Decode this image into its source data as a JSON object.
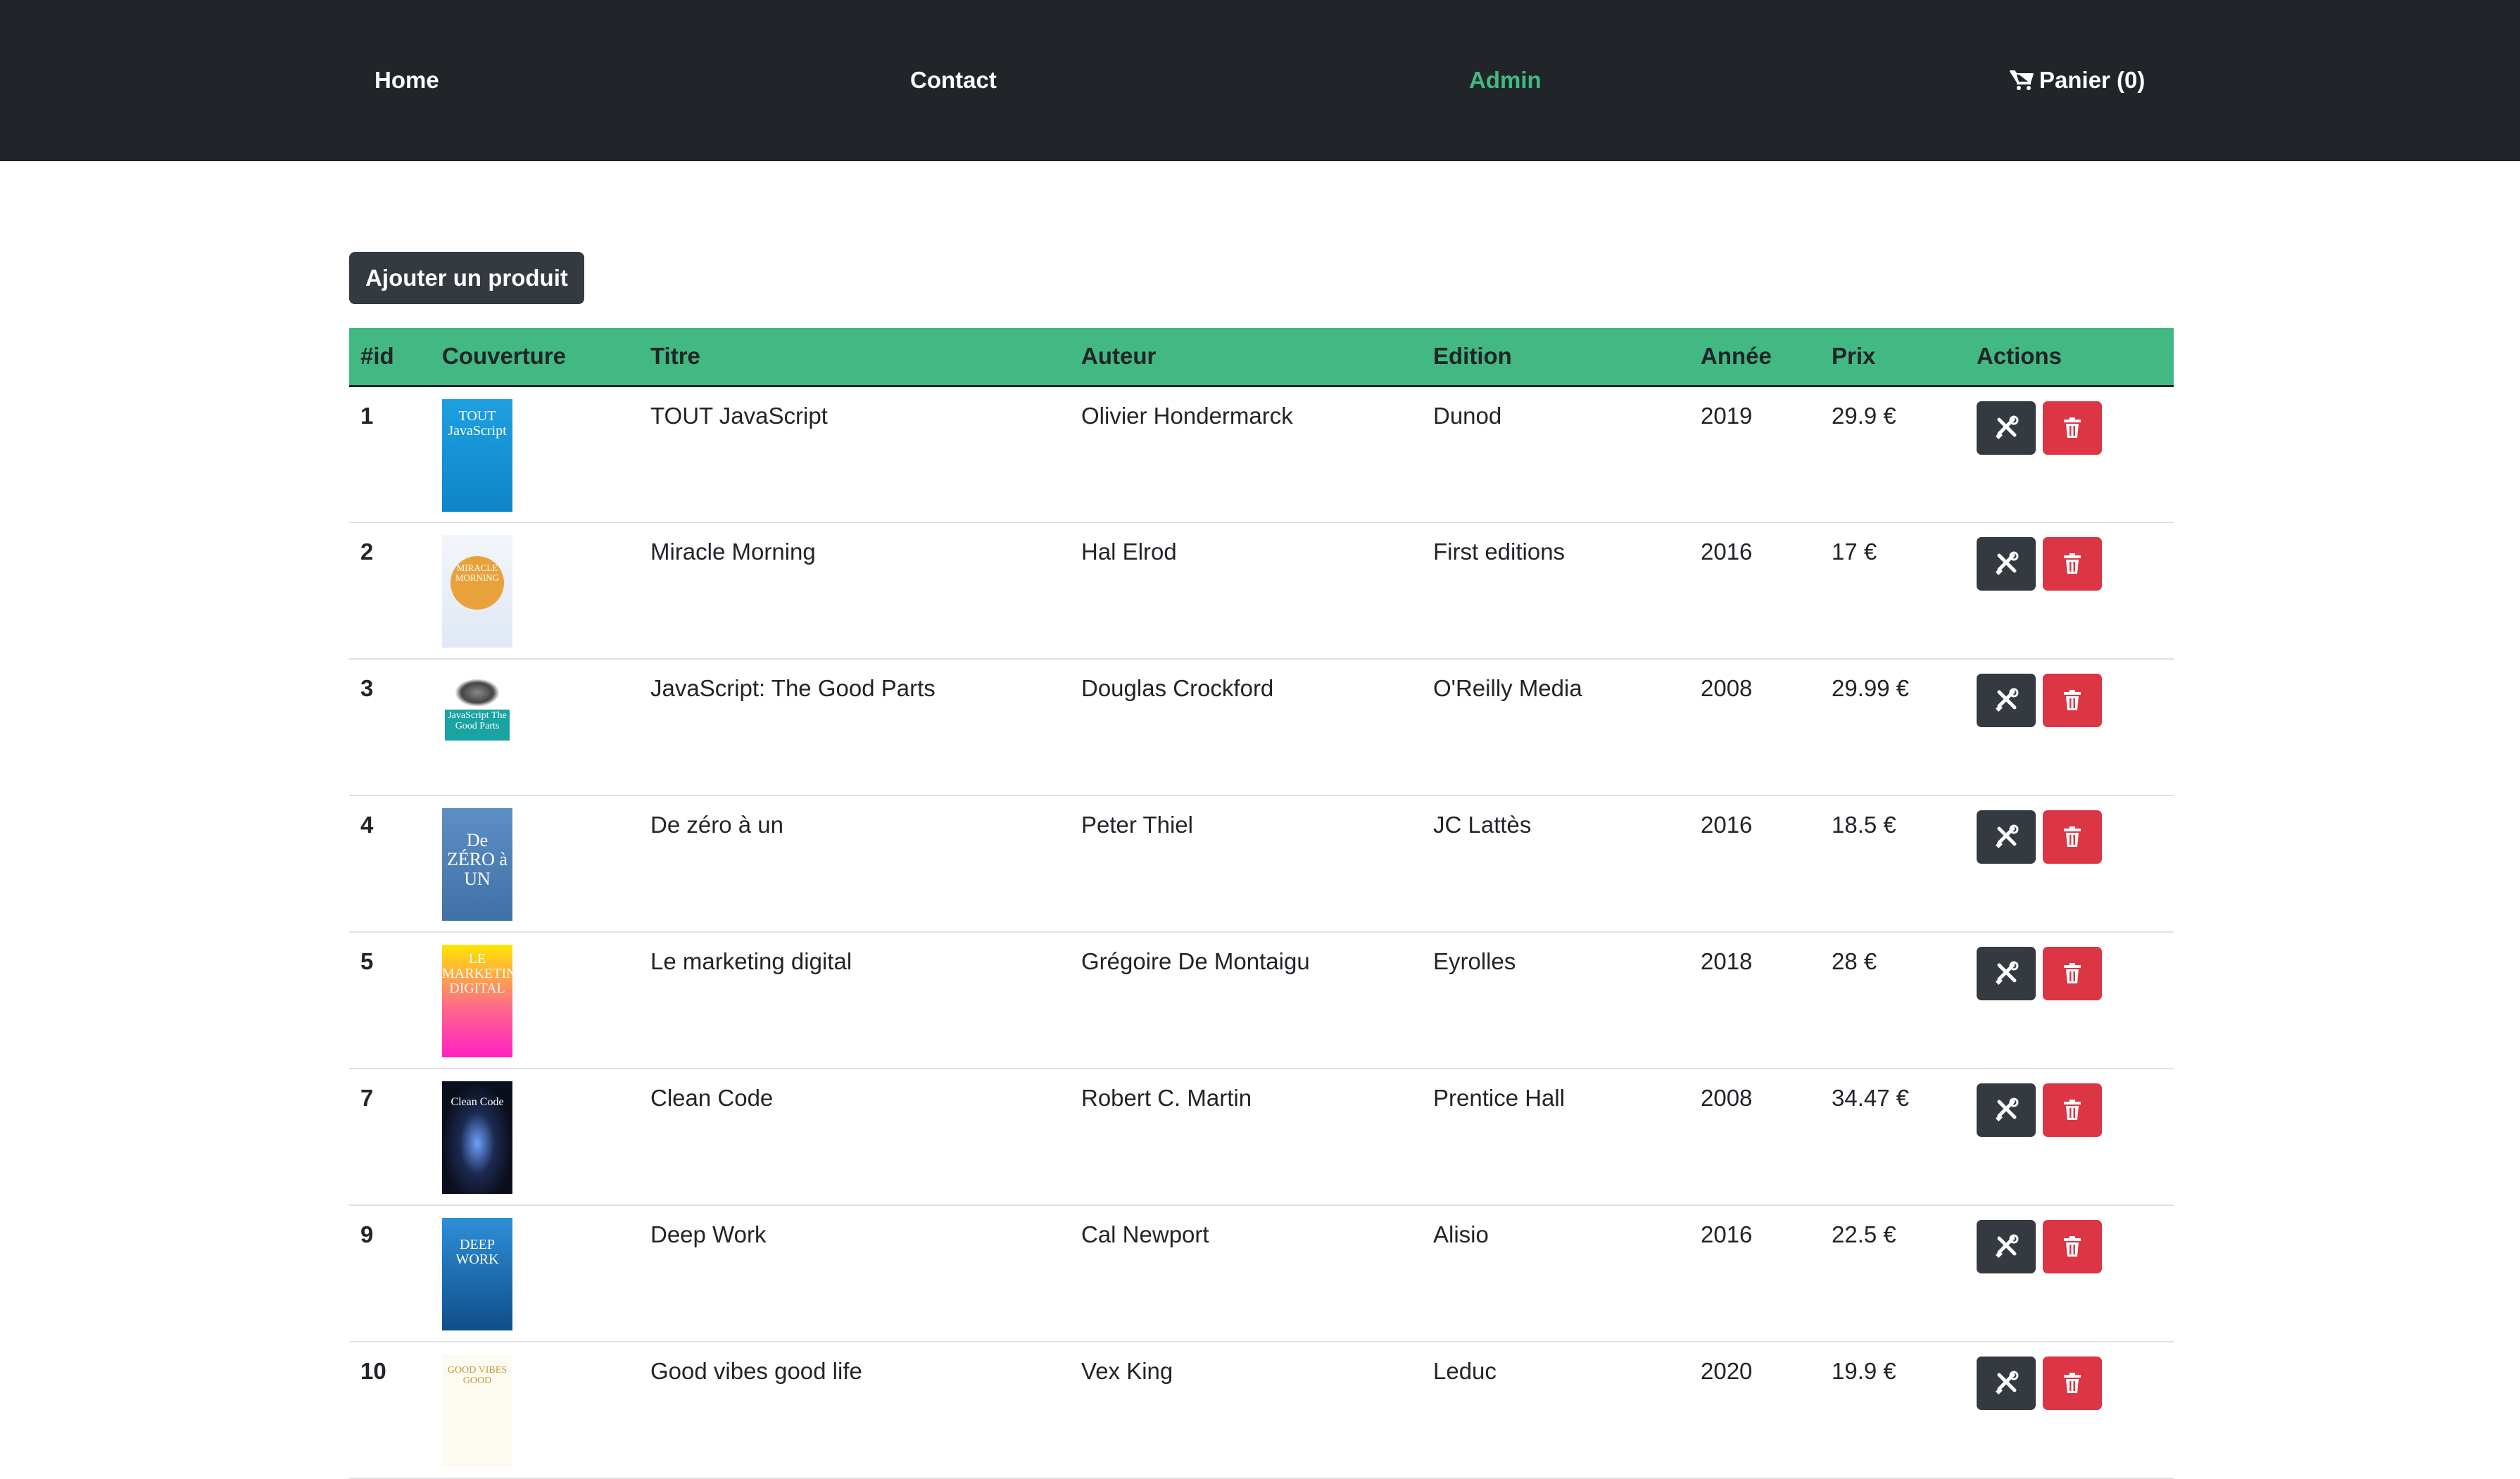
{
  "nav": {
    "home": "Home",
    "contact": "Contact",
    "admin": "Admin",
    "cart": "Panier (0)"
  },
  "toolbar": {
    "add_label": "Ajouter un produit"
  },
  "table": {
    "headers": [
      "#id",
      "Couverture",
      "Titre",
      "Auteur",
      "Edition",
      "Année",
      "Prix",
      "Actions"
    ],
    "rows": [
      {
        "id": "1",
        "title": "TOUT JavaScript",
        "author": "Olivier Hondermarck",
        "edition": "Dunod",
        "year": "2019",
        "price": "29.9 €",
        "cover_text": "TOUT JavaScript"
      },
      {
        "id": "2",
        "title": "Miracle Morning",
        "author": "Hal Elrod",
        "edition": "First editions",
        "year": "2016",
        "price": "17 €",
        "cover_text": "MIRACLE MORNING"
      },
      {
        "id": "3",
        "title": "JavaScript: The Good Parts",
        "author": "Douglas Crockford",
        "edition": "O'Reilly Media",
        "year": "2008",
        "price": "29.99 €",
        "cover_text": "JavaScript The Good Parts"
      },
      {
        "id": "4",
        "title": "De zéro à un",
        "author": "Peter Thiel",
        "edition": "JC Lattès",
        "year": "2016",
        "price": "18.5 €",
        "cover_text": "De ZÉRO à UN"
      },
      {
        "id": "5",
        "title": "Le marketing digital",
        "author": "Grégoire De Montaigu",
        "edition": "Eyrolles",
        "year": "2018",
        "price": "28 €",
        "cover_text": "LE MARKETING DIGITAL"
      },
      {
        "id": "7",
        "title": "Clean Code",
        "author": "Robert C. Martin",
        "edition": "Prentice Hall",
        "year": "2008",
        "price": "34.47 €",
        "cover_text": "Clean Code"
      },
      {
        "id": "9",
        "title": "Deep Work",
        "author": "Cal Newport",
        "edition": "Alisio",
        "year": "2016",
        "price": "22.5 €",
        "cover_text": "DEEP WORK"
      },
      {
        "id": "10",
        "title": "Good vibes good life",
        "author": "Vex King",
        "edition": "Leduc",
        "year": "2020",
        "price": "19.9 €",
        "cover_text": "GOOD VIBES GOOD"
      }
    ]
  },
  "colors": {
    "navbar_bg": "#212529",
    "accent_green": "#42b883",
    "edit_button": "#343a40",
    "delete_button": "#dc3545"
  },
  "icons": {
    "cart": "shopping-cart-icon",
    "edit": "tools-icon",
    "delete": "trash-icon"
  }
}
